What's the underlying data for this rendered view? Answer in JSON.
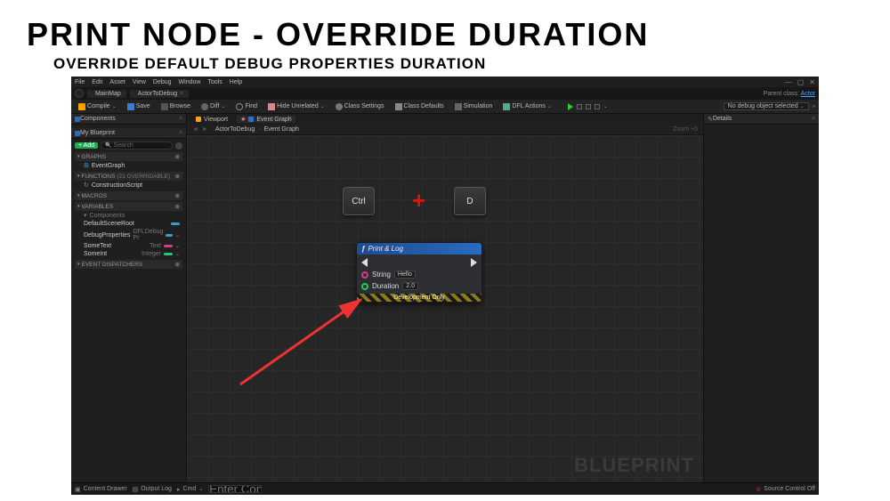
{
  "slide": {
    "title": "PRINT NODE - OVERRIDE DURATION",
    "subtitle": "OVERRIDE DEFAULT DEBUG PROPERTIES DURATION"
  },
  "menubar": [
    "File",
    "Edit",
    "Asset",
    "View",
    "Debug",
    "Window",
    "Tools",
    "Help"
  ],
  "map_tab": "MainMap",
  "bp_tab": "ActorToDebug",
  "parent_label": "Parent class:",
  "parent_class": "Actor",
  "toolbar": {
    "compile": "Compile",
    "save": "Save",
    "browse": "Browse",
    "diff": "Diff",
    "find": "Find",
    "hide": "Hide Unrelated",
    "class_settings": "Class Settings",
    "class_defaults": "Class Defaults",
    "simulation": "Simulation",
    "dfl": "DFL Actions",
    "debug_sel": "No debug object selected"
  },
  "left": {
    "components_tab": "Components",
    "blueprint_tab": "My Blueprint",
    "add": "+ Add",
    "search_placeholder": "Search",
    "sections": {
      "graphs": "GRAPHS",
      "functions": "FUNCTIONS",
      "func_hint": "(21 OVERRIDABLE)",
      "macros": "MACROS",
      "variables": "VARIABLES",
      "event": "EVENT DISPATCHERS"
    },
    "graph_item": "EventGraph",
    "func_item": "ConstructionScript",
    "var_group": "Components",
    "vars": [
      {
        "name": "DefaultSceneRoot",
        "type": "",
        "bar": "bar-b"
      },
      {
        "name": "DebugProperties",
        "type": "DFLDebug Pr",
        "bar": "bar-b"
      },
      {
        "name": "SomeText",
        "type": "Text",
        "bar": "bar-t"
      },
      {
        "name": "SomeInt",
        "type": "Integer",
        "bar": "bar-i"
      }
    ]
  },
  "mid": {
    "viewport_tab": "Viewport",
    "graph_tab": "Event Graph",
    "crumb1": "ActorToDebug",
    "crumb2": "Event Graph",
    "zoom": "Zoom +5",
    "watermark": "BLUEPRINT",
    "keys": {
      "ctrl": "Ctrl",
      "d": "D"
    },
    "node": {
      "title": "Print & Log",
      "string_label": "String",
      "string_value": "Hello",
      "duration_label": "Duration",
      "duration_value": "2.0",
      "footer": "Development Only"
    }
  },
  "right_tab": "Details",
  "statusbar": {
    "drawer": "Content Drawer",
    "output": "Output Log",
    "cmd": "Cmd",
    "cmd_placeholder": "Enter Console Command",
    "source": "Source Control Off"
  }
}
